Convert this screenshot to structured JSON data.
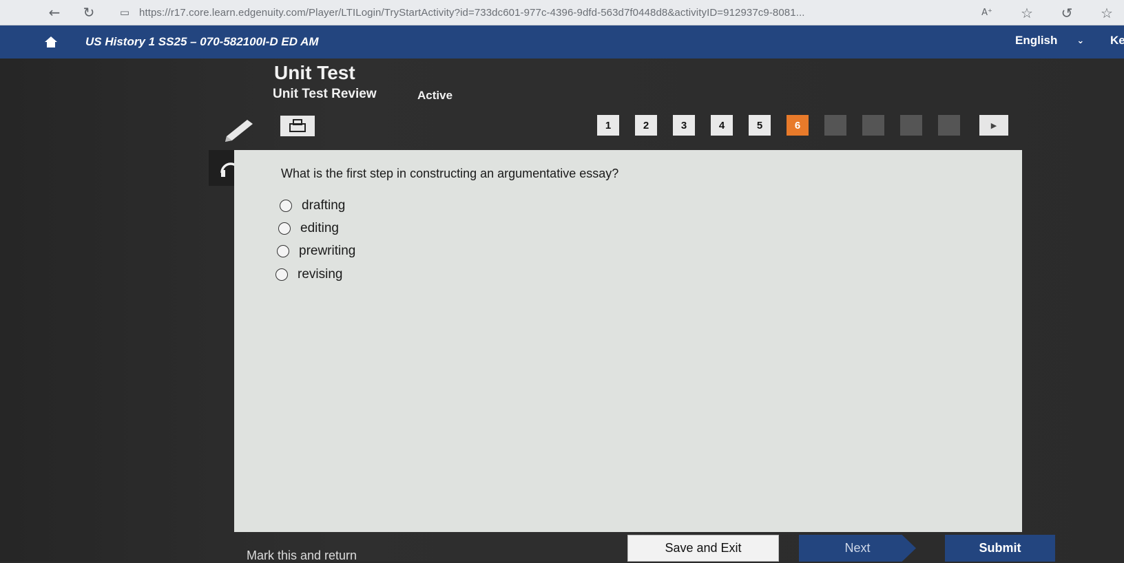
{
  "browser": {
    "url": "https://r17.core.learn.edgenuity.com/Player/LTILogin/TryStartActivity?id=733dc601-977c-4396-9dfd-563d7f0448d8&activityID=912937c9-8081...",
    "back_icon": "back-arrow-icon",
    "refresh_icon": "refresh-icon"
  },
  "header": {
    "course_title": "US History 1 SS25 – 070-582100I-D ED AM",
    "language": "English",
    "user_initials": "Ke",
    "bg_color": "#23457f"
  },
  "activity": {
    "title": "Unit Test",
    "subtitle": "Unit Test Review",
    "status": "Active"
  },
  "question_nav": {
    "items": [
      "1",
      "2",
      "3",
      "4",
      "5",
      "6"
    ],
    "current": "6",
    "accent_color": "#e87a2a"
  },
  "question": {
    "prompt": "What is the first step in constructing an argumentative essay?",
    "options": [
      "drafting",
      "editing",
      "prewriting",
      "revising"
    ]
  },
  "footer": {
    "mark_return": "Mark this and return",
    "save_exit": "Save and Exit",
    "next": "Next",
    "submit": "Submit"
  }
}
